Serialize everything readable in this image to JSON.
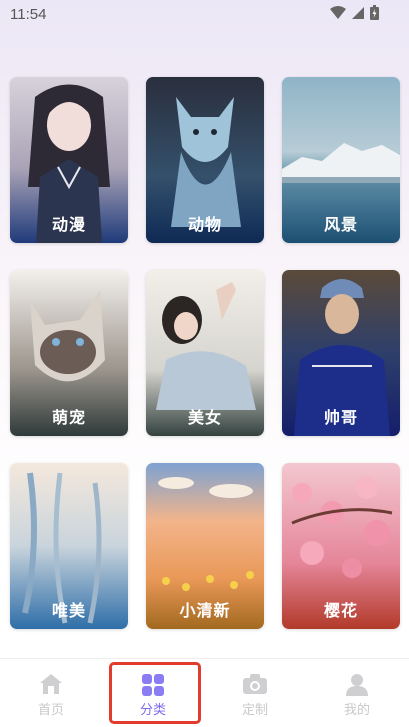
{
  "status": {
    "time": "11:54"
  },
  "categories": [
    {
      "label": "动漫"
    },
    {
      "label": "动物"
    },
    {
      "label": "风景"
    },
    {
      "label": "萌宠"
    },
    {
      "label": "美女"
    },
    {
      "label": "帅哥"
    },
    {
      "label": "唯美"
    },
    {
      "label": "小清新"
    },
    {
      "label": "樱花"
    }
  ],
  "tabbar": {
    "items": [
      {
        "label": "首页",
        "icon": "home-icon"
      },
      {
        "label": "分类",
        "icon": "category-grid-icon",
        "active": true
      },
      {
        "label": "定制",
        "icon": "camera-icon"
      },
      {
        "label": "我的",
        "icon": "profile-icon"
      }
    ],
    "colors": {
      "active": "#7c6cf0",
      "inactive": "#c9c9cc",
      "highlight": "#e13c2e"
    }
  }
}
